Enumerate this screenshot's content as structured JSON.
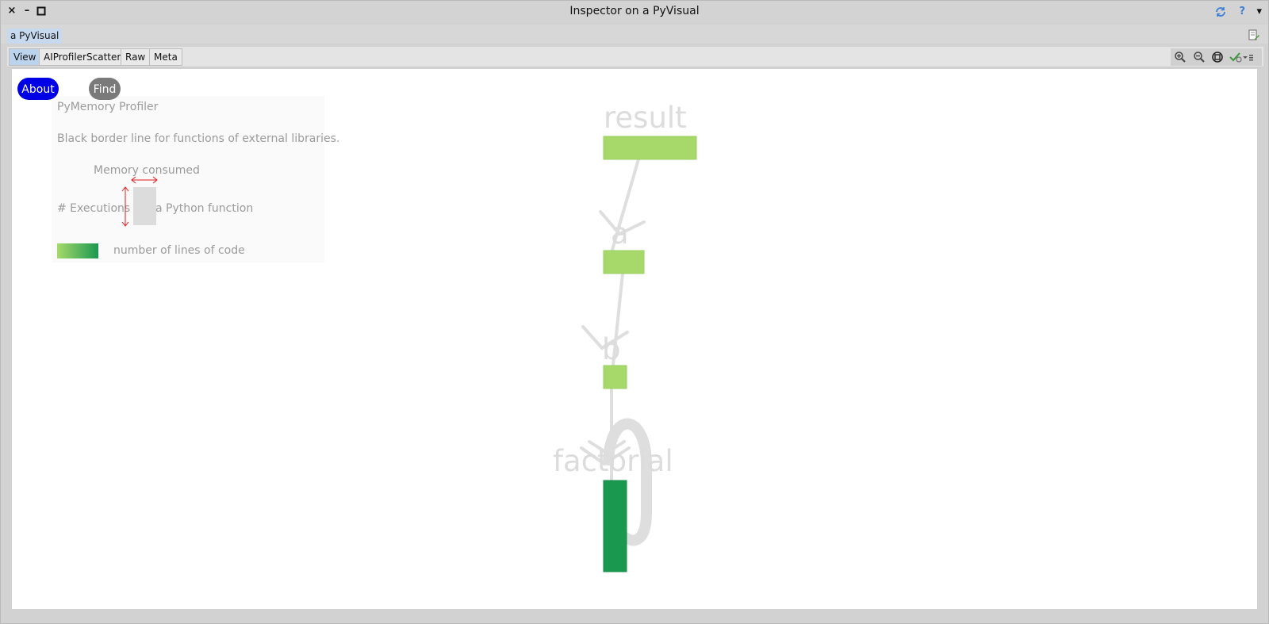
{
  "window": {
    "title": "Inspector on a PyVisual",
    "close_glyph": "×",
    "minimize_glyph": "–",
    "help_glyph": "?",
    "menu_glyph": "▾"
  },
  "inspector_tab": {
    "label": "a PyVisual"
  },
  "subtabs": [
    {
      "label": "View",
      "active": true
    },
    {
      "label": "AIProfilerScatter",
      "active": false
    },
    {
      "label": "Raw",
      "active": false
    },
    {
      "label": "Meta",
      "active": false
    }
  ],
  "toolbar": {
    "icons": [
      "zoom-in-icon",
      "zoom-out-icon",
      "zoom-fit-icon",
      "check-settings-icon"
    ]
  },
  "buttons": {
    "about_label": "About",
    "find_label": "Find",
    "about_color": "#0000e6",
    "find_color": "#7a7a7a"
  },
  "legend": {
    "title": "PyMemory Profiler",
    "border_note": "Black border line for functions of external libraries.",
    "memory_label": "Memory consumed",
    "executions_label": "# Executions",
    "function_label": "a Python function",
    "gradient_label": "number of lines of code",
    "gradient_start": "#a6d96a",
    "gradient_end": "#1a9850",
    "arrow_color": "#e41a1c"
  },
  "graph": {
    "nodes": [
      {
        "name": "result",
        "color": "#a6d96a"
      },
      {
        "name": "a",
        "color": "#a6d96a"
      },
      {
        "name": "b",
        "color": "#a6d96a"
      },
      {
        "name": "factorial",
        "color": "#1a9850"
      }
    ],
    "edge_color": "#dedede"
  }
}
